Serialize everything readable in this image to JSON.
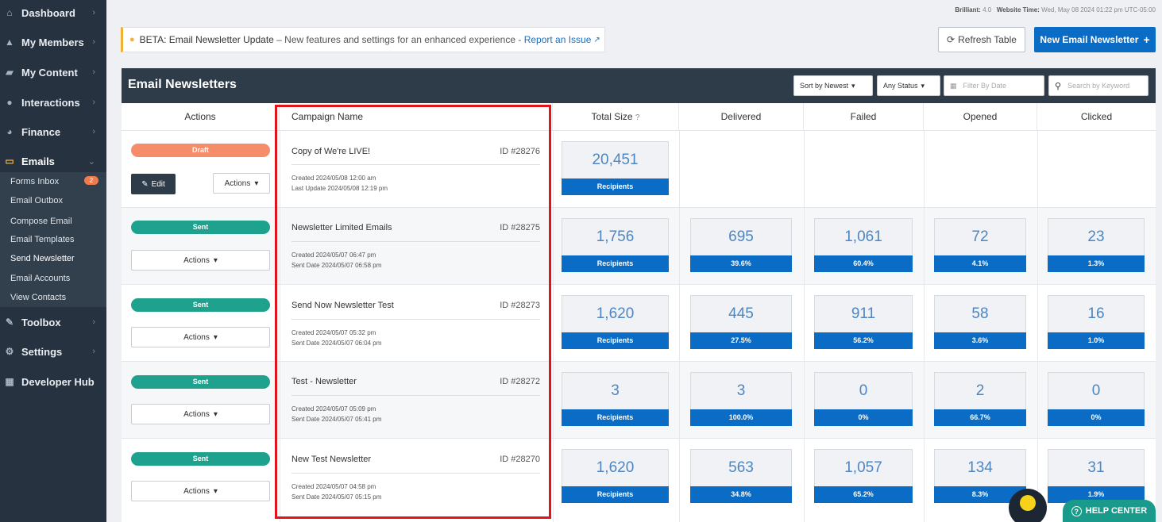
{
  "sidebar": {
    "items": [
      {
        "label": "Dashboard",
        "icon": "home-icon",
        "glyph": "⌂"
      },
      {
        "label": "My Members",
        "icon": "users-icon",
        "glyph": "👥"
      },
      {
        "label": "My Content",
        "icon": "folder-icon",
        "glyph": "▰"
      },
      {
        "label": "Interactions",
        "icon": "comments-icon",
        "glyph": "●"
      },
      {
        "label": "Finance",
        "icon": "pie-chart-icon",
        "glyph": "◕"
      },
      {
        "label": "Emails",
        "icon": "inbox-icon",
        "glyph": "▭"
      },
      {
        "label": "Toolbox",
        "icon": "wrench-icon",
        "glyph": "✎"
      },
      {
        "label": "Settings",
        "icon": "gear-icon",
        "glyph": "⚙"
      },
      {
        "label": "Developer Hub",
        "icon": "grid-icon",
        "glyph": "▦"
      }
    ],
    "sub_items": [
      "Forms Inbox",
      "Email Outbox",
      "Compose Email",
      "Email Templates",
      "Send Newsletter",
      "Email Accounts",
      "View Contacts"
    ],
    "forms_inbox_count": "2"
  },
  "system": {
    "brilliant_label": "Brilliant:",
    "brilliant_value": "4.0",
    "time_label": "Website Time:",
    "time_value": "Wed, May 08 2024 01:22 pm UTC-05:00"
  },
  "beta": {
    "title": "BETA: Email Newsletter Update",
    "text": " – New features and settings for an enhanced experience - ",
    "link": "Report an Issue"
  },
  "buttons": {
    "refresh": "Refresh Table",
    "new": "New Email Newsletter"
  },
  "panel": {
    "title": "Email Newsletters",
    "sort": "Sort by Newest",
    "status": "Any Status",
    "date_placeholder": "Filter By Date",
    "search_placeholder": "Search by Keyword"
  },
  "columns": [
    "Actions",
    "Campaign Name",
    "Total Size",
    "Delivered",
    "Failed",
    "Opened",
    "Clicked"
  ],
  "rows": [
    {
      "status": "Draft",
      "edit": "Edit",
      "actions": "Actions",
      "name": "Copy of We're LIVE!",
      "id": "ID #28276",
      "meta1": "Created 2024/05/08 12:00 am",
      "meta2": "Last Update 2024/05/08 12:19 pm",
      "total": "20,451",
      "total_label": "Recipients"
    },
    {
      "status": "Sent",
      "actions": "Actions",
      "name": "Newsletter Limited Emails",
      "id": "ID #28275",
      "meta1": "Created 2024/05/07 06:47 pm",
      "meta2": "Sent Date 2024/05/07 06:58 pm",
      "total": "1,756",
      "total_label": "Recipients",
      "delivered": "695",
      "delivered_pct": "39.6%",
      "failed": "1,061",
      "failed_pct": "60.4%",
      "opened": "72",
      "opened_pct": "4.1%",
      "clicked": "23",
      "clicked_pct": "1.3%"
    },
    {
      "status": "Sent",
      "actions": "Actions",
      "name": "Send Now Newsletter Test",
      "id": "ID #28273",
      "meta1": "Created 2024/05/07 05:32 pm",
      "meta2": "Sent Date 2024/05/07 06:04 pm",
      "total": "1,620",
      "total_label": "Recipients",
      "delivered": "445",
      "delivered_pct": "27.5%",
      "failed": "911",
      "failed_pct": "56.2%",
      "opened": "58",
      "opened_pct": "3.6%",
      "clicked": "16",
      "clicked_pct": "1.0%"
    },
    {
      "status": "Sent",
      "actions": "Actions",
      "name": "Test - Newsletter",
      "id": "ID #28272",
      "meta1": "Created 2024/05/07 05:09 pm",
      "meta2": "Sent Date 2024/05/07 05:41 pm",
      "total": "3",
      "total_label": "Recipients",
      "delivered": "3",
      "delivered_pct": "100.0%",
      "failed": "0",
      "failed_pct": "0%",
      "opened": "2",
      "opened_pct": "66.7%",
      "clicked": "0",
      "clicked_pct": "0%"
    },
    {
      "status": "Sent",
      "actions": "Actions",
      "name": "New Test Newsletter",
      "id": "ID #28270",
      "meta1": "Created 2024/05/07 04:58 pm",
      "meta2": "Sent Date 2024/05/07 05:15 pm",
      "total": "1,620",
      "total_label": "Recipients",
      "delivered": "563",
      "delivered_pct": "34.8%",
      "failed": "1,057",
      "failed_pct": "65.2%",
      "opened": "134",
      "opened_pct": "8.3%",
      "clicked": "31",
      "clicked_pct": "1.9%"
    }
  ],
  "help": {
    "label": "HELP CENTER"
  },
  "colors": {
    "primary": "#0b6cc6",
    "sent": "#1ea18d",
    "draft": "#f58d6b",
    "sidebar": "#26323f",
    "highlight": "#e0141b"
  }
}
